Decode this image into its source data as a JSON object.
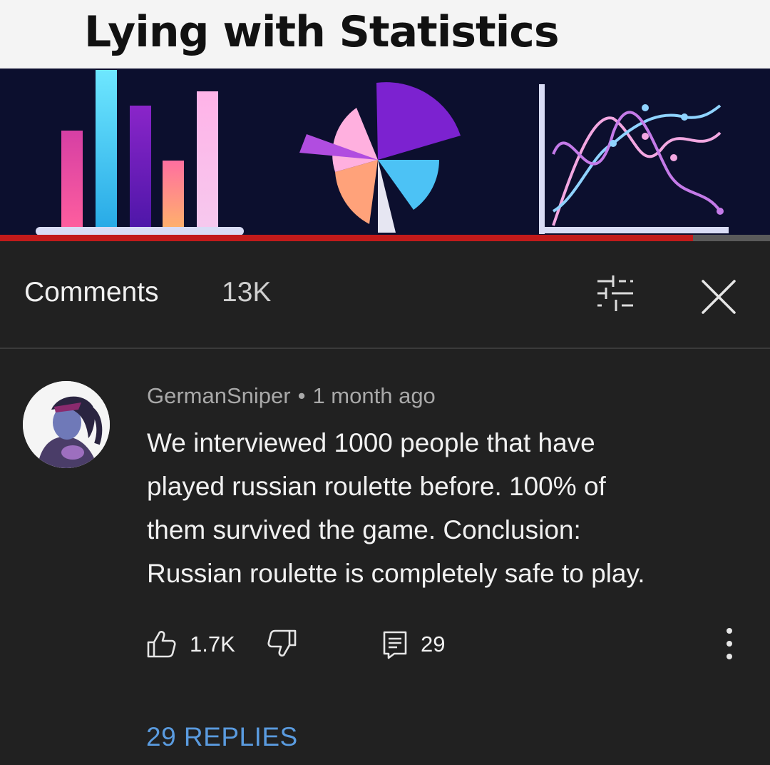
{
  "thumbnail": {
    "title": "Lying with Statistics",
    "progress_fraction": 0.9
  },
  "header": {
    "title": "Comments",
    "count": "13K",
    "filter_icon": "filter-sliders-icon",
    "close_icon": "close-icon"
  },
  "comment": {
    "author": "GermanSniper",
    "separator": "•",
    "time": "1 month ago",
    "text": "We interviewed 1000 people that have\nplayed russian roulette before. 100% of\nthem survived the game. Conclusion:\nRussian roulette is completely safe to play.",
    "likes": "1.7K",
    "reply_count": "29",
    "replies_link": "29 REPLIES"
  },
  "colors": {
    "background": "#212121",
    "link": "#5a9bdf",
    "progress": "#c21a1a"
  }
}
